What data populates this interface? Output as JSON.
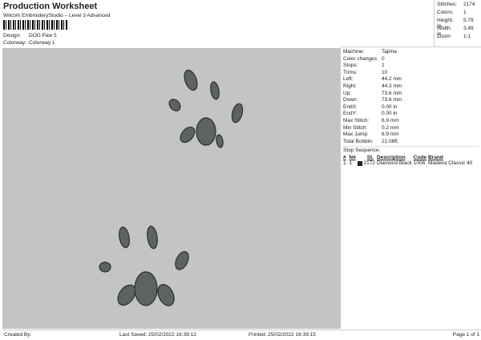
{
  "header": {
    "title": "Production Worksheet",
    "subtitle": "Wilcom EmbroideryStudio – Level 3 Advanced",
    "design_label": "Design:",
    "design": "DOG Paw 5",
    "colorway_label": "Colorway:",
    "colorway": "Colorway 1"
  },
  "stats": [
    {
      "k": "Stitches:",
      "v": "2174"
    },
    {
      "k": "Colors:",
      "v": "1"
    },
    {
      "k": "Height:",
      "v": "5.79 in"
    },
    {
      "k": "Width:",
      "v": "3.49 in"
    },
    {
      "k": "Zoom:",
      "v": "1:1"
    }
  ],
  "details": [
    {
      "k": "Machine:",
      "v": "Tajima"
    },
    {
      "k": "Color changes:",
      "v": "0"
    },
    {
      "k": "Stops:",
      "v": "1"
    },
    {
      "k": "Trims:",
      "v": "10"
    },
    {
      "k": "Left:",
      "v": "44.2 mm"
    },
    {
      "k": "Right:",
      "v": "44.3 mm"
    },
    {
      "k": "Up:",
      "v": "73.6 mm"
    },
    {
      "k": "Down:",
      "v": "73.6 mm"
    },
    {
      "k": "EndX:",
      "v": "0.00 in"
    },
    {
      "k": "EndY:",
      "v": "0.00 in"
    },
    {
      "k": "Max Stitch:",
      "v": "6.9 mm"
    },
    {
      "k": "Min Stitch:",
      "v": "0.2 mm"
    },
    {
      "k": "Max Jump:",
      "v": "6.9 mm"
    },
    {
      "k": "Total Bobbin:",
      "v": "21.08ft"
    }
  ],
  "stop_sequence": {
    "label": "Stop Sequence:",
    "headers": [
      "#",
      "N#",
      "St.",
      "Description",
      "Code",
      "Brand"
    ],
    "rows": [
      [
        "1.",
        "1",
        "2172",
        "Diamond Black",
        "1006",
        "Madeira Classic 40"
      ]
    ],
    "swatch_color": "#222222"
  },
  "footer": {
    "created_by": "Created By:",
    "last_saved": "Last Saved: 25/02/2022 16:39:13",
    "printed": "Printed: 25/02/2022 16:39:15",
    "page": "Page 1 of 1"
  }
}
